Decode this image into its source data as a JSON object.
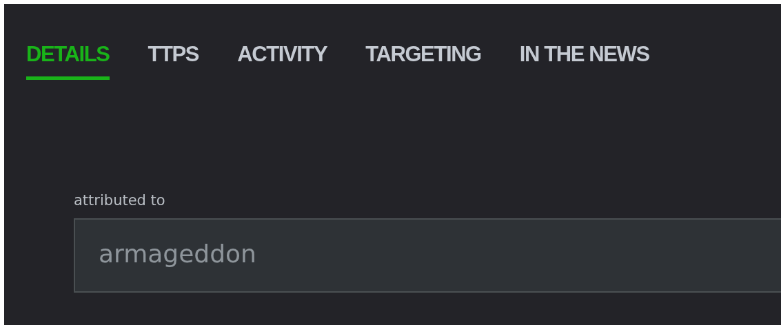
{
  "tabs": [
    {
      "label": "DETAILS",
      "selected": true
    },
    {
      "label": "TTPS",
      "selected": false
    },
    {
      "label": "ACTIVITY",
      "selected": false
    },
    {
      "label": "TARGETING",
      "selected": false
    },
    {
      "label": "IN THE NEWS",
      "selected": false
    }
  ],
  "field": {
    "label": "attributed to",
    "value": "armageddon"
  }
}
